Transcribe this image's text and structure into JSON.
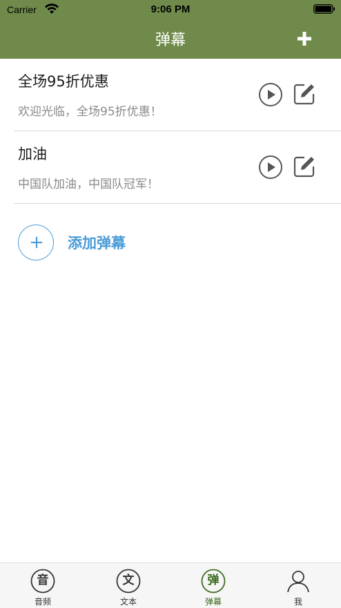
{
  "status_bar": {
    "carrier": "Carrier",
    "time": "9:06 PM",
    "wifi_icon": "wifi-icon",
    "battery_icon": "battery-icon"
  },
  "nav": {
    "title": "弹幕",
    "add_icon": "plus-icon",
    "background": "#6f8a4a"
  },
  "items": [
    {
      "title": "全场95折优惠",
      "subtitle": "欢迎光临，全场95折优惠！",
      "play_icon": "play-icon",
      "edit_icon": "edit-icon"
    },
    {
      "title": "加油",
      "subtitle": "中国队加油，中国队冠军！",
      "play_icon": "play-icon",
      "edit_icon": "edit-icon"
    }
  ],
  "add_entry": {
    "icon": "plus-circle-icon",
    "label": "添加弹幕",
    "color": "#4a9bd6"
  },
  "tabbar": {
    "tabs": [
      {
        "label": "音频",
        "icon_glyph": "音",
        "icon": "audio-icon",
        "selected": false
      },
      {
        "label": "文本",
        "icon_glyph": "文",
        "icon": "text-icon",
        "selected": false
      },
      {
        "label": "弹幕",
        "icon_glyph": "弹",
        "icon": "danmaku-icon",
        "selected": true
      },
      {
        "label": "我",
        "icon_glyph": "",
        "icon": "person-icon",
        "selected": false
      }
    ],
    "selected_color": "#3d6b1f",
    "normal_color": "#333333"
  }
}
